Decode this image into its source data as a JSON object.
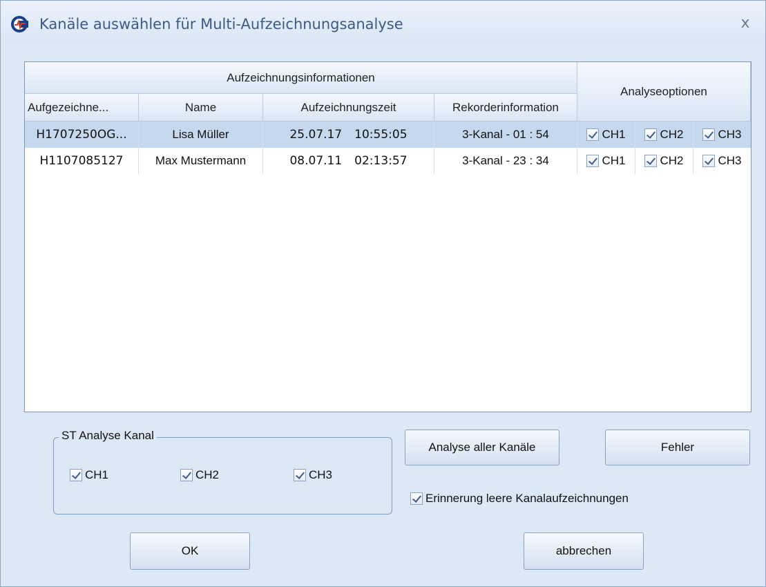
{
  "window": {
    "title": "Kanäle auswählen für Multi-Aufzeichnungsanalyse",
    "close_label": "x"
  },
  "table": {
    "group_header_info": "Aufzeichnungsinformationen",
    "group_header_options": "Analyseoptionen",
    "columns": [
      "Aufgezeichne...",
      "Name",
      "Aufzeichnungszeit",
      "Rekorderinformation"
    ],
    "rows": [
      {
        "id": "H1707250OG...",
        "name": "Lisa Müller",
        "date": "25.07.17",
        "time": "10:55:05",
        "recorder": "3-Kanal - 01 : 54",
        "ch": [
          "CH1",
          "CH2",
          "CH3"
        ],
        "checked": [
          true,
          true,
          true
        ],
        "selected": true
      },
      {
        "id": "H1107085127",
        "name": "Max Mustermann",
        "date": "08.07.11",
        "time": "02:13:57",
        "recorder": "3-Kanal - 23 : 34",
        "ch": [
          "CH1",
          "CH2",
          "CH3"
        ],
        "checked": [
          true,
          true,
          true
        ],
        "selected": false
      }
    ]
  },
  "st_channel": {
    "title": "ST Analyse Kanal",
    "channels": [
      "CH1",
      "CH2",
      "CH3"
    ],
    "checked": [
      true,
      true,
      true
    ]
  },
  "buttons": {
    "analyze_all": "Analyse aller Kanäle",
    "error": "Fehler",
    "ok": "OK",
    "cancel": "abbrechen"
  },
  "reminder": {
    "label": "Erinnerung leere Kanalaufzeichnungen",
    "checked": true
  },
  "colors": {
    "window_bg": "#dde8f6",
    "selected_row": "#c6d8ee",
    "title_text": "#3c5a86"
  }
}
